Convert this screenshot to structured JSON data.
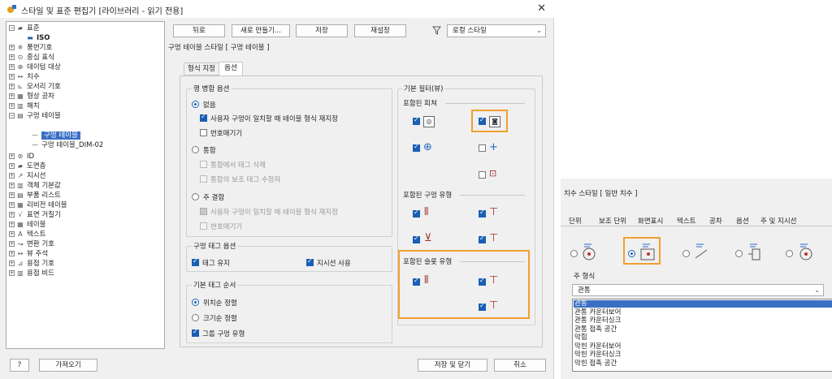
{
  "dialog": {
    "title": "스타일 및 표준 편집기 [라이브러리 - 읽기 전용]",
    "close": "✕"
  },
  "tree": {
    "root": "표준",
    "iso": "ISO",
    "items": [
      "풍번기호",
      "중심 표식",
      "데이텀 대상",
      "치수",
      "모서리 기호",
      "형상 공차",
      "해치",
      "구멍 테이블"
    ],
    "child_selected": "구멍 테이블",
    "child2": "구멍 테이블_DIM-02",
    "items2": [
      "ID",
      "도면층",
      "지시선",
      "객체 기본값",
      "부품 리스트",
      "리비전 테이블",
      "표면 거칠기",
      "테이블",
      "텍스트",
      "변환 기호",
      "뷰 주석",
      "용접 기호",
      "용접 비드"
    ]
  },
  "toolbar": {
    "back": "뒤로",
    "new": "새로 만들기...",
    "save": "저장",
    "reset": "재설정",
    "filter_value": "로컬 스타일"
  },
  "header": {
    "style_title": "구멍 테이블 스타일 [ 구멍 테이블 ]"
  },
  "tabs": [
    "형식 지정",
    "옵션"
  ],
  "row_merge": {
    "title": "행 병합 옵션",
    "opt_none": "없음",
    "none_chk": "사용자 구멍이 일치할 때 테이블 형식 재지정",
    "none_chk2": "번호매기기",
    "opt_merge": "통합",
    "merge_chk1": "통합에서 태그 삭제",
    "merge_chk2": "통합의 보조 태그 수정자",
    "opt_dup": "주 결합",
    "dup_chk1": "사용자 구멍이 일치할 때 테이블 형식 재지정",
    "dup_chk2": "번호매기기"
  },
  "tag_opts": {
    "title": "구멍 태그 옵션",
    "keep": "태그 유지",
    "use_leader": "지시선 사용"
  },
  "tag_order": {
    "title": "기본 태그 순서",
    "by_loc": "위치순 정렬",
    "by_size": "크기순 정렬",
    "group": "그룹 구멍 유형"
  },
  "filters": {
    "title": "기본 필터(뷰)",
    "included_features": "포함된 피쳐",
    "included_holes": "포함된 구멍 유형",
    "included_pockets": "포함된 슬롯 유형"
  },
  "footer": {
    "import": "가져오기",
    "save_close": "저장 및 닫기",
    "cancel": "취소"
  },
  "dim_style": {
    "title": "치수 스타일 [ 일반 치수 ]",
    "tabs": [
      "단위",
      "보조 단위",
      "화면표시",
      "텍스트",
      "공차",
      "옵션",
      "주 및 지시선"
    ],
    "note_form_label": "주 형식",
    "combo_value": "관통",
    "options": [
      "관통",
      "관통 카운터보어",
      "관통 카운터싱크",
      "관통 접촉 공간",
      "막힘",
      "막힌 카운터보어",
      "막힌 카운터싱크",
      "막힌 접촉 공간"
    ]
  },
  "colors": {
    "accent": "#1a5fb4",
    "highlight": "#f0a030",
    "selection": "#3a6fc4"
  }
}
